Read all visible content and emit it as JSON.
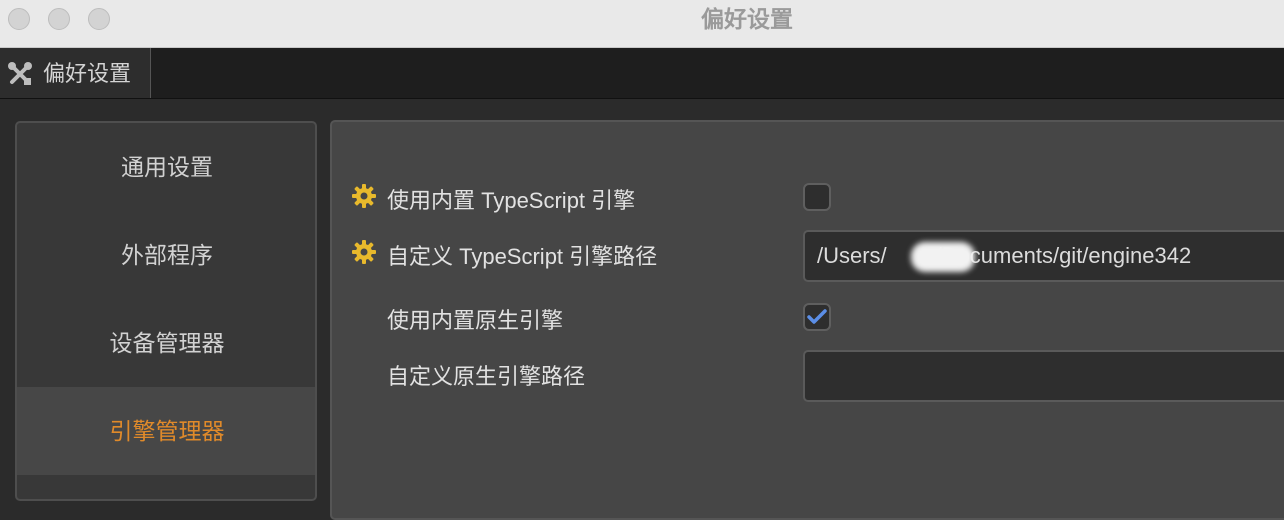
{
  "window": {
    "title": "偏好设置"
  },
  "tab": {
    "label": "偏好设置",
    "icon": "tools-icon"
  },
  "sidebar": {
    "items": [
      {
        "label": "通用设置",
        "active": false
      },
      {
        "label": "外部程序",
        "active": false
      },
      {
        "label": "设备管理器",
        "active": false
      },
      {
        "label": "引擎管理器",
        "active": true
      }
    ]
  },
  "settings": {
    "use_builtin_ts": {
      "label": "使用内置 TypeScript 引擎",
      "checked": false,
      "icon": "gear-icon"
    },
    "custom_ts_path": {
      "label": "自定义 TypeScript 引擎路径",
      "value": "/Users/        /Documents/git/engine342",
      "icon": "gear-icon"
    },
    "use_builtin_native": {
      "label": "使用内置原生引擎",
      "checked": true
    },
    "custom_native_path": {
      "label": "自定义原生引擎路径",
      "value": ""
    }
  },
  "colors": {
    "accent": "#e08a2a",
    "gear": "#e8b92c",
    "check": "#5b8ee6"
  }
}
